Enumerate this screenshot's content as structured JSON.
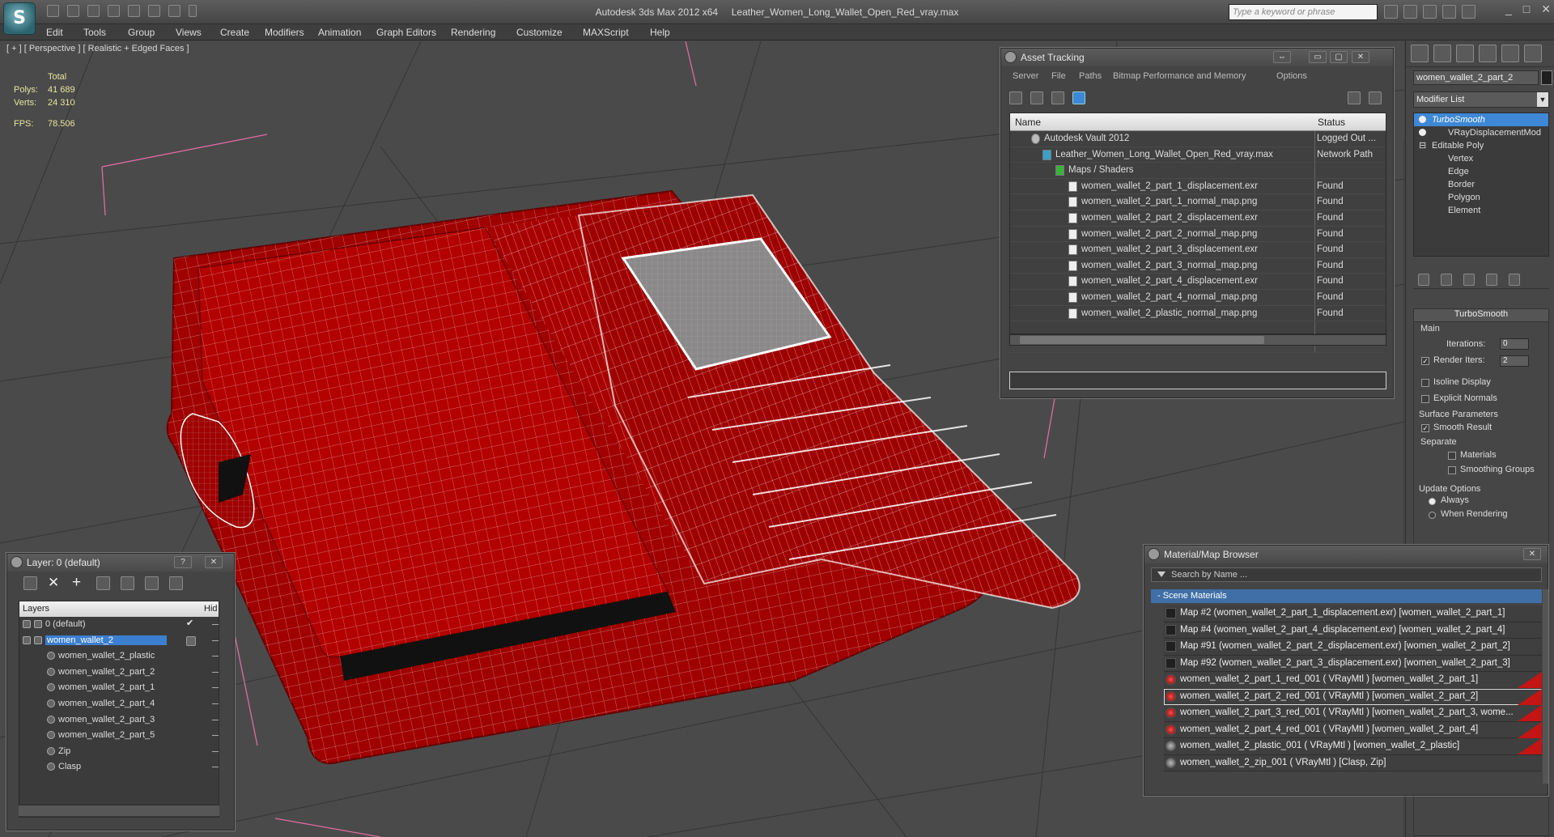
{
  "title_bar": {
    "app_name": "Autodesk 3ds Max  2012 x64",
    "file_name": "Leather_Women_Long_Wallet_Open_Red_vray.max",
    "search_placeholder": "Type a keyword or phrase",
    "logo_letter": "S"
  },
  "menu": [
    "Edit",
    "Tools",
    "Group",
    "Views",
    "Create",
    "Modifiers",
    "Animation",
    "Graph Editors",
    "Rendering",
    "Customize",
    "MAXScript",
    "Help"
  ],
  "viewport": {
    "label": "[ + ] [ Perspective ] [ Realistic + Edged Faces ]",
    "stats": {
      "total_label": "Total",
      "polys_label": "Polys:",
      "polys": "41 689",
      "verts_label": "Verts:",
      "verts": "24 310",
      "fps_label": "FPS:",
      "fps": "78.506"
    }
  },
  "command_panel": {
    "object_name": "women_wallet_2_part_2",
    "modifier_list": "Modifier List",
    "stack": [
      {
        "label": "TurboSmooth",
        "selected": true,
        "bulb": true
      },
      {
        "label": "VRayDisplacementMod",
        "selected": false,
        "bulb": true
      },
      {
        "label": "Editable Poly",
        "selected": false,
        "bulb": false,
        "expander": "⊟"
      },
      {
        "label": "Vertex",
        "selected": false,
        "sub": true
      },
      {
        "label": "Edge",
        "selected": false,
        "sub": true
      },
      {
        "label": "Border",
        "selected": false,
        "sub": true
      },
      {
        "label": "Polygon",
        "selected": false,
        "sub": true
      },
      {
        "label": "Element",
        "selected": false,
        "sub": true
      }
    ],
    "turbosmooth": {
      "title": "TurboSmooth",
      "main": "Main",
      "iterations_label": "Iterations:",
      "iterations": "0",
      "render_iters_label": "Render Iters:",
      "render_iters": "2",
      "render_iters_checked": true,
      "isoline_label": "Isoline Display",
      "explicit_label": "Explicit Normals",
      "surface_params": "Surface Parameters",
      "smooth_result": "Smooth Result",
      "separate": "Separate",
      "materials": "Materials",
      "smoothing_groups": "Smoothing Groups",
      "update_options": "Update Options",
      "always": "Always",
      "when_rendering": "When Rendering"
    }
  },
  "asset_tracking": {
    "title": "Asset Tracking",
    "menu": [
      "Server",
      "File",
      "Paths",
      "Bitmap Performance and Memory",
      "Options"
    ],
    "columns": {
      "name": "Name",
      "status": "Status"
    },
    "rows": [
      {
        "name": "Autodesk Vault 2012",
        "status": "Logged Out ...",
        "indent": 1,
        "icon": "vault-icon"
      },
      {
        "name": "Leather_Women_Long_Wallet_Open_Red_vray.max",
        "status": "Network Path",
        "indent": 2,
        "icon": "max-file-icon"
      },
      {
        "name": "Maps / Shaders",
        "status": "",
        "indent": 3,
        "icon": "maps-folder-icon"
      },
      {
        "name": "women_wallet_2_part_1_displacement.exr",
        "status": "Found",
        "indent": 4,
        "icon": "image-file-icon"
      },
      {
        "name": "women_wallet_2_part_1_normal_map.png",
        "status": "Found",
        "indent": 4,
        "icon": "image-file-icon"
      },
      {
        "name": "women_wallet_2_part_2_displacement.exr",
        "status": "Found",
        "indent": 4,
        "icon": "image-file-icon"
      },
      {
        "name": "women_wallet_2_part_2_normal_map.png",
        "status": "Found",
        "indent": 4,
        "icon": "image-file-icon"
      },
      {
        "name": "women_wallet_2_part_3_displacement.exr",
        "status": "Found",
        "indent": 4,
        "icon": "image-file-icon"
      },
      {
        "name": "women_wallet_2_part_3_normal_map.png",
        "status": "Found",
        "indent": 4,
        "icon": "image-file-icon"
      },
      {
        "name": "women_wallet_2_part_4_displacement.exr",
        "status": "Found",
        "indent": 4,
        "icon": "image-file-icon"
      },
      {
        "name": "women_wallet_2_part_4_normal_map.png",
        "status": "Found",
        "indent": 4,
        "icon": "image-file-icon"
      },
      {
        "name": "women_wallet_2_plastic_normal_map.png",
        "status": "Found",
        "indent": 4,
        "icon": "image-file-icon"
      },
      {
        "name": "",
        "status": "",
        "indent": 0,
        "icon": ""
      },
      {
        "name": "",
        "status": "",
        "indent": 0,
        "icon": ""
      }
    ]
  },
  "layer_window": {
    "title": "Layer: 0 (default)",
    "col_layers": "Layers",
    "col_hide": "Hid",
    "rows": [
      {
        "name": "0 (default)",
        "level": 0,
        "check": true,
        "selected": false
      },
      {
        "name": "women_wallet_2",
        "level": 0,
        "check": false,
        "selected": true
      },
      {
        "name": "women_wallet_2_plastic",
        "level": 1
      },
      {
        "name": "women_wallet_2_part_2",
        "level": 1
      },
      {
        "name": "women_wallet_2_part_1",
        "level": 1
      },
      {
        "name": "women_wallet_2_part_4",
        "level": 1
      },
      {
        "name": "women_wallet_2_part_3",
        "level": 1
      },
      {
        "name": "women_wallet_2_part_5",
        "level": 1
      },
      {
        "name": "Zip",
        "level": 1
      },
      {
        "name": "Clasp",
        "level": 1
      }
    ]
  },
  "material_browser": {
    "title": "Material/Map Browser",
    "search_placeholder": "Search by Name ...",
    "group": "- Scene Materials",
    "rows": [
      {
        "name": "Map #2 (women_wallet_2_part_1_displacement.exr)  [women_wallet_2_part_1]",
        "swatch": "map",
        "red": false
      },
      {
        "name": "Map #4 (women_wallet_2_part_4_displacement.exr)  [women_wallet_2_part_4]",
        "swatch": "map",
        "red": false
      },
      {
        "name": "Map #91 (women_wallet_2_part_2_displacement.exr)  [women_wallet_2_part_2]",
        "swatch": "map",
        "red": false
      },
      {
        "name": "Map #92 (women_wallet_2_part_3_displacement.exr)  [women_wallet_2_part_3]",
        "swatch": "map",
        "red": false
      },
      {
        "name": "women_wallet_2_part_1_red_001  ( VRayMtl )  [women_wallet_2_part_1]",
        "swatch": "red",
        "red": true
      },
      {
        "name": "women_wallet_2_part_2_red_001  ( VRayMtl )  [women_wallet_2_part_2]",
        "swatch": "red",
        "red": true,
        "highlight": true
      },
      {
        "name": "women_wallet_2_part_3_red_001  ( VRayMtl )  [women_wallet_2_part_3, wome...",
        "swatch": "red",
        "red": true
      },
      {
        "name": "women_wallet_2_part_4_red_001  ( VRayMtl )  [women_wallet_2_part_4]",
        "swatch": "red",
        "red": true
      },
      {
        "name": "women_wallet_2_plastic_001  ( VRayMtl )  [women_wallet_2_plastic]",
        "swatch": "grey",
        "red": true
      },
      {
        "name": "women_wallet_2_zip_001  ( VRayMtl )  [Clasp, Zip]",
        "swatch": "grey",
        "red": false
      }
    ]
  },
  "colors": {
    "accent": "#3e88d6",
    "wallet_red": "#a00000",
    "viewport_bg": "#4a4a4a"
  }
}
